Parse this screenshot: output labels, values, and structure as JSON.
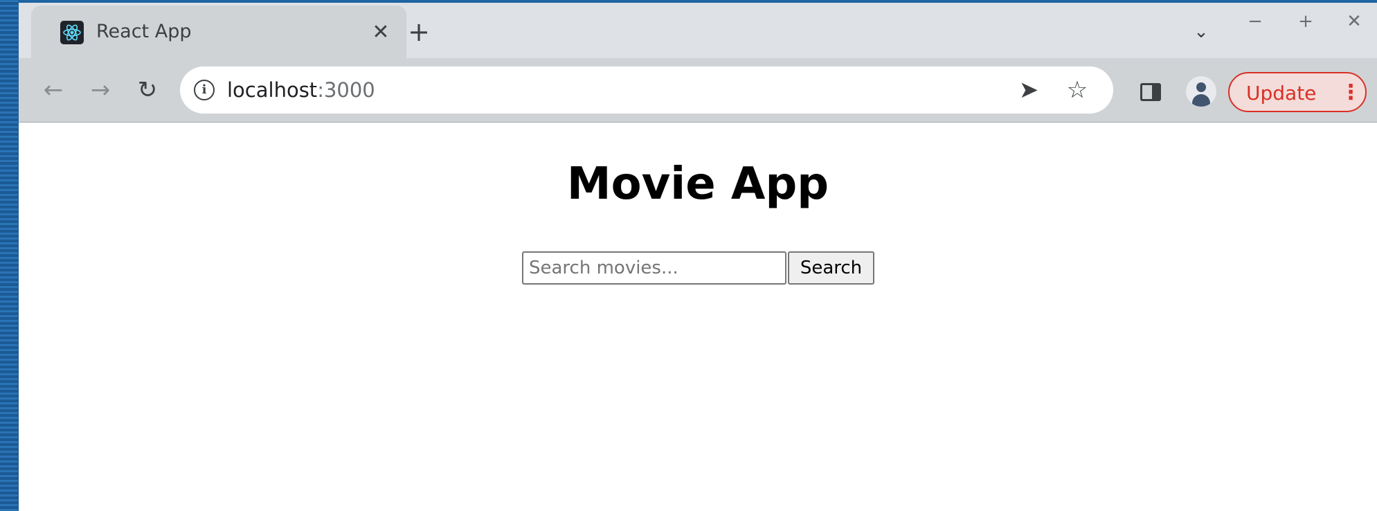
{
  "browser": {
    "tab": {
      "title": "React App",
      "close_glyph": "✕"
    },
    "new_tab_glyph": "+",
    "tab_search_glyph": "⌄",
    "window_controls": {
      "minimize": "−",
      "maximize": "+",
      "close": "✕"
    },
    "nav": {
      "back_glyph": "←",
      "forward_glyph": "→",
      "reload_glyph": "↻"
    },
    "omnibox": {
      "info_glyph": "i",
      "host": "localhost",
      "port": ":3000",
      "send_glyph": "➤",
      "star_glyph": "☆"
    },
    "update_button": {
      "label": "Update",
      "menu_glyph": "⋮"
    },
    "colors": {
      "update_red": "#d93025",
      "toolbar": "#cfd3d6",
      "tabstrip": "#dee1e6"
    }
  },
  "page": {
    "title": "Movie App",
    "search": {
      "placeholder": "Search movies...",
      "value": "",
      "button_label": "Search"
    }
  }
}
